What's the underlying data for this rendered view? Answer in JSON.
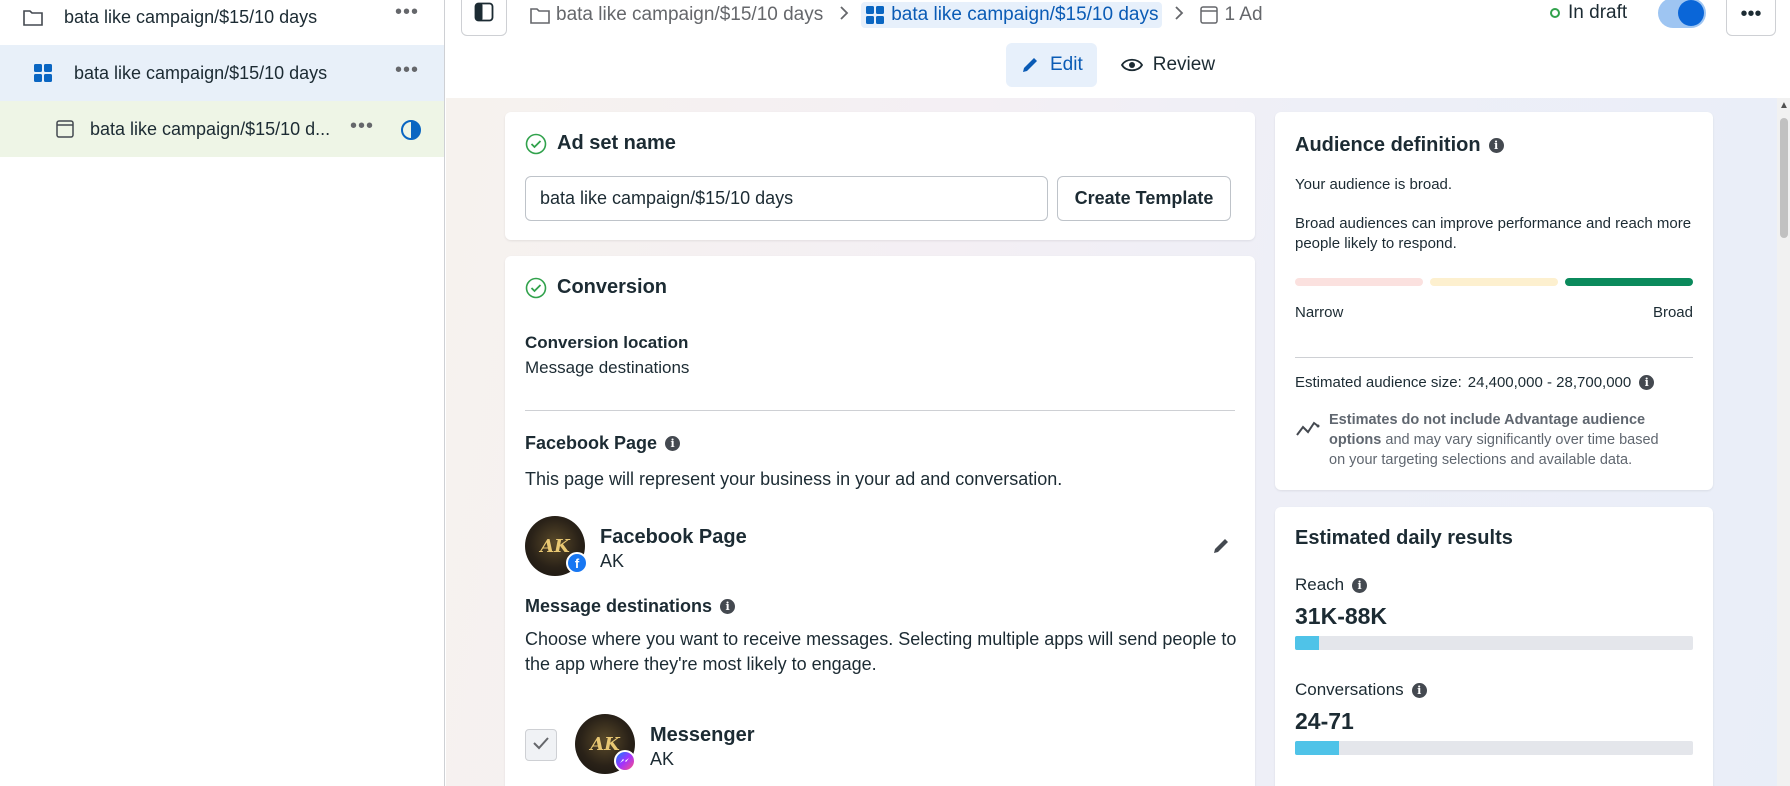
{
  "tree": {
    "items": [
      {
        "label": "bata like campaign/$15/10 days",
        "icon": "folder-icon"
      },
      {
        "label": "bata like campaign/$15/10 days",
        "icon": "adset-grid-icon"
      },
      {
        "label": "bata like campaign/$15/10 d...",
        "icon": "ad-page-icon"
      }
    ],
    "more": "•••"
  },
  "header": {
    "breadcrumbs": [
      {
        "label": "bata like campaign/$15/10 days",
        "icon": "folder-icon"
      },
      {
        "label": "bata like campaign/$15/10 days",
        "icon": "adset-grid-icon"
      },
      {
        "label": "1 Ad",
        "icon": "ad-page-icon"
      }
    ],
    "status": "In draft",
    "status_color": "#31a24c",
    "more": "•••",
    "tabs": [
      {
        "label": "Edit",
        "icon": "pencil-icon"
      },
      {
        "label": "Review",
        "icon": "eye-icon"
      }
    ]
  },
  "adset": {
    "title": "Ad set name",
    "name_value": "bata like campaign/$15/10 days",
    "template_button": "Create Template"
  },
  "conversion": {
    "title": "Conversion",
    "location_label": "Conversion location",
    "location_value": "Message destinations",
    "fb_page_label": "Facebook Page",
    "fb_page_desc": "This page will represent your business in your ad and conversation.",
    "page_name": "Facebook Page",
    "page_sub": "AK",
    "avatar_text": "AK",
    "dest_label": "Message destinations",
    "dest_desc_line1": "Choose where you want to receive messages. Selecting multiple apps will send people to",
    "dest_desc_line2": "the app where they're most likely to engage.",
    "messenger_name": "Messenger",
    "messenger_sub": "AK"
  },
  "audience": {
    "title": "Audience definition",
    "broad_text": "Your audience is broad.",
    "desc_line1": "Broad audiences can improve performance and reach more",
    "desc_line2": "people likely to respond.",
    "narrow": "Narrow",
    "broad": "Broad",
    "size_label": "Estimated audience size:",
    "size_value": "24,400,000 - 28,700,000",
    "note_bold1": "Estimates do not include Advantage audience",
    "note_bold2": "options",
    "note_rest1": " and may vary significantly over time based",
    "note_rest2": "on your targeting selections and available data.",
    "meter_colors": [
      "#fbe1df",
      "#fdf0cf",
      "#0b8a5c"
    ]
  },
  "results": {
    "title": "Estimated daily results",
    "reach_label": "Reach",
    "reach_value": "31K-88K",
    "reach_fill_percent": 6,
    "conv_label": "Conversations",
    "conv_value": "24-71",
    "conv_fill_percent": 11
  }
}
